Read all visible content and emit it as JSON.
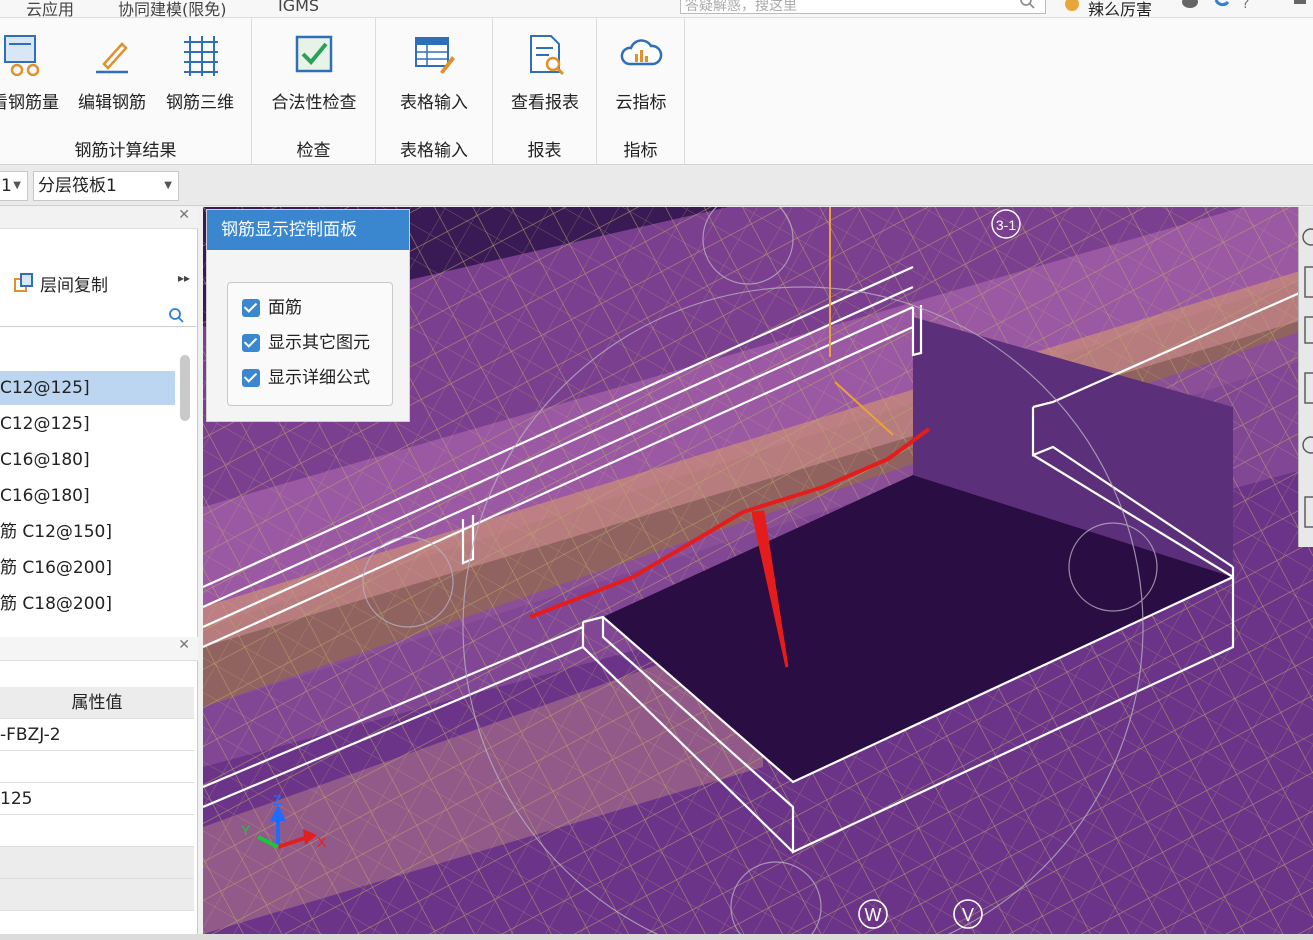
{
  "top_menu": {
    "items": [
      "云应用",
      "协同建模(限免)",
      "IGMS"
    ],
    "search_placeholder": "答疑解惑，搜这里",
    "user_label": "辣么厉害"
  },
  "ribbon": {
    "groups": [
      {
        "label": "钢筋计算结果",
        "buttons": [
          "看钢筋量",
          "编辑钢筋",
          "钢筋三维"
        ]
      },
      {
        "label": "检查",
        "buttons": [
          "合法性检查"
        ]
      },
      {
        "label": "表格输入",
        "buttons": [
          "表格输入"
        ]
      },
      {
        "label": "报表",
        "buttons": [
          "查看报表"
        ]
      },
      {
        "label": "指标",
        "buttons": [
          "云指标"
        ]
      }
    ]
  },
  "selectors": {
    "floor_value": "1",
    "component_value": "分层筏板1"
  },
  "left_panel": {
    "copy_button": "层间复制",
    "list_items": [
      "C12@125]",
      "C12@125]",
      "C16@180]",
      "C16@180]",
      "筋 C12@150]",
      "筋 C16@200]",
      "筋 C18@200]"
    ],
    "selected_index": 0,
    "property_header": "属性值",
    "property_values": [
      "-FBZJ-2",
      "",
      "125",
      "",
      "",
      ""
    ]
  },
  "rebar_panel": {
    "title": "钢筋显示控制面板",
    "options": [
      {
        "label": "面筋",
        "checked": true
      },
      {
        "label": "显示其它图元",
        "checked": true
      },
      {
        "label": "显示详细公式",
        "checked": true
      }
    ]
  },
  "viewport": {
    "axis_labels": [
      "W",
      "V",
      "3-1"
    ],
    "gizmo": {
      "x": "X",
      "y": "Y",
      "z": "Z"
    }
  }
}
